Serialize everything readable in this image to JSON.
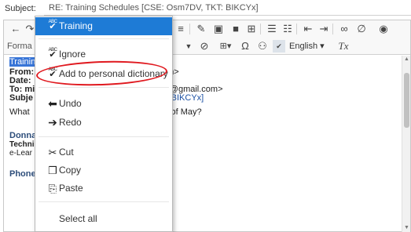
{
  "subject": {
    "label": "Subject:",
    "value": "RE: Training Schedules [CSE: Osm7DV, TKT: BIKCYx]"
  },
  "toolbar": {
    "format_label": "Forma",
    "language_label": "English",
    "omega": "Ω",
    "clear_format": "Tx"
  },
  "email": {
    "selected_word": "Trainin",
    "from_label": "From:",
    "from_tail": "l.com>",
    "date_label": "Date:",
    "to_label": "To: mi",
    "to_tail": "glab@gmail.com>",
    "subject_label": "Subje",
    "ticket_text": "TKT: BIKCYx]",
    "body_start": "What",
    "body_tail": "onth of May?",
    "sig_name": "Donna",
    "sig_title": "Techni",
    "sig_org": "e-Lear",
    "phone_label": "Phone"
  },
  "context_menu": {
    "items": [
      {
        "label": "Training",
        "icon": "spellcheck-icon"
      },
      {
        "label": "Ignore",
        "icon": "spellcheck-icon"
      },
      {
        "label": "Add to personal dictionary",
        "icon": "spellcheck-icon"
      },
      {
        "label": "Undo",
        "icon": "undo-arrow-icon"
      },
      {
        "label": "Redo",
        "icon": "redo-arrow-icon"
      },
      {
        "label": "Cut",
        "icon": "scissors-icon"
      },
      {
        "label": "Copy",
        "icon": "copy-icon"
      },
      {
        "label": "Paste",
        "icon": "clipboard-icon"
      },
      {
        "label": "Select all",
        "icon": ""
      }
    ]
  },
  "colors": {
    "highlight": "#1e7bd6",
    "annotation": "#e0191f",
    "selection": "#3875d7"
  }
}
